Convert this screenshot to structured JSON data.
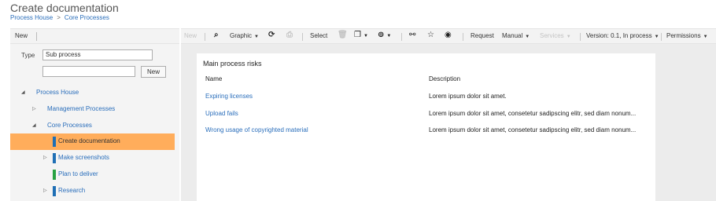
{
  "header": {
    "title": "Create documentation",
    "breadcrumbs": [
      "Process House",
      "Core Processes"
    ],
    "breadcrumb_sep": ">"
  },
  "left": {
    "toolbar": {
      "new_label": "New",
      "collapse_glyph": "‹"
    },
    "form": {
      "type_label": "Type",
      "type_value": "Sub process",
      "name_value": "",
      "new_button": "New"
    },
    "tree": [
      {
        "label": "Process House",
        "expanded": true
      },
      {
        "label": "Management Processes",
        "expanded": false
      },
      {
        "label": "Core Processes",
        "expanded": true
      },
      {
        "label": "Create documentation",
        "selected": true,
        "color": "#1f6fb5"
      },
      {
        "label": "Make screenshots",
        "expanded": false,
        "color": "#1f6fb5"
      },
      {
        "label": "Plan to deliver",
        "color": "#27a243"
      },
      {
        "label": "Research",
        "expanded": false,
        "color": "#1f6fb5"
      }
    ]
  },
  "toolbar": {
    "new": "New",
    "graphic": "Graphic",
    "select": "Select",
    "request": "Request",
    "manual": "Manual",
    "services": "Services",
    "version": "Version: 0.1, In process",
    "permissions": "Permissions",
    "icons": [
      "search-icon",
      "refresh-icon",
      "print-icon",
      "delete-icon",
      "copy-icon",
      "export-icon",
      "link-icon",
      "favorite-icon",
      "watch-icon"
    ]
  },
  "panel": {
    "title": "Main process risks",
    "columns": [
      "Name",
      "Description"
    ],
    "rows": [
      {
        "name": "Expiring licenses",
        "description": "Lorem ipsum dolor sit amet."
      },
      {
        "name": "Upload fails",
        "description": "Lorem ipsum dolor sit amet, consetetur sadipscing elitr, sed diam nonum..."
      },
      {
        "name": "Wrong usage of copyrighted material",
        "description": "Lorem ipsum dolor sit amet, consetetur sadipscing elitr, sed diam nonum..."
      }
    ]
  },
  "colors": {
    "accent": "#2a6ebb",
    "selected": "#ffad5b",
    "green": "#27a243",
    "blue": "#1f6fb5"
  }
}
